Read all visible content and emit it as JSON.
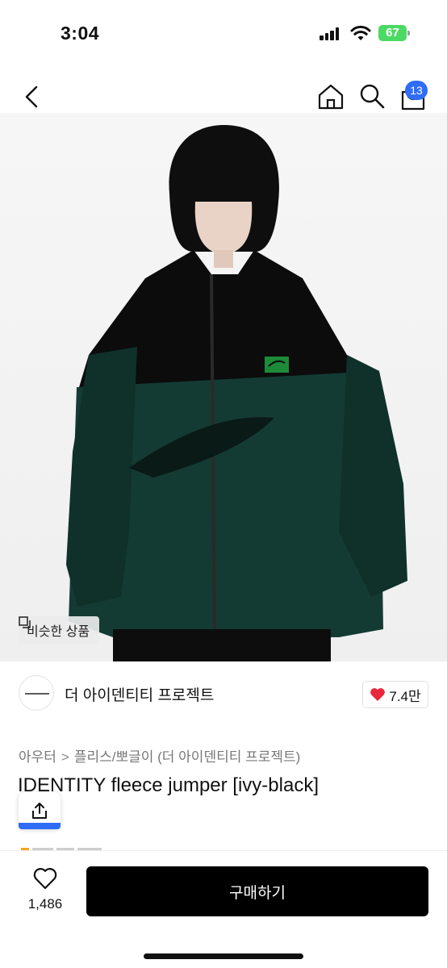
{
  "status_bar": {
    "time": "3:04",
    "battery": "67"
  },
  "nav": {
    "cart_count": "13"
  },
  "image": {
    "similar_label": "비슷한 상품"
  },
  "brand": {
    "name": "더 아이덴티티 프로젝트",
    "likes": "7.4만"
  },
  "breadcrumb": {
    "category": "아우터",
    "separator": ">",
    "subcategory": "플리스/뽀글이 (더 아이덴티티 프로젝트)"
  },
  "product": {
    "title": "IDENTITY fleece jumper [ivy-black]"
  },
  "bottom": {
    "wish_count": "1,486",
    "buy_label": "구매하기"
  },
  "colors": {
    "accent": "#2f6df6",
    "buy_button": "#000000",
    "heart": "#e8283c",
    "battery": "#4cd964"
  }
}
